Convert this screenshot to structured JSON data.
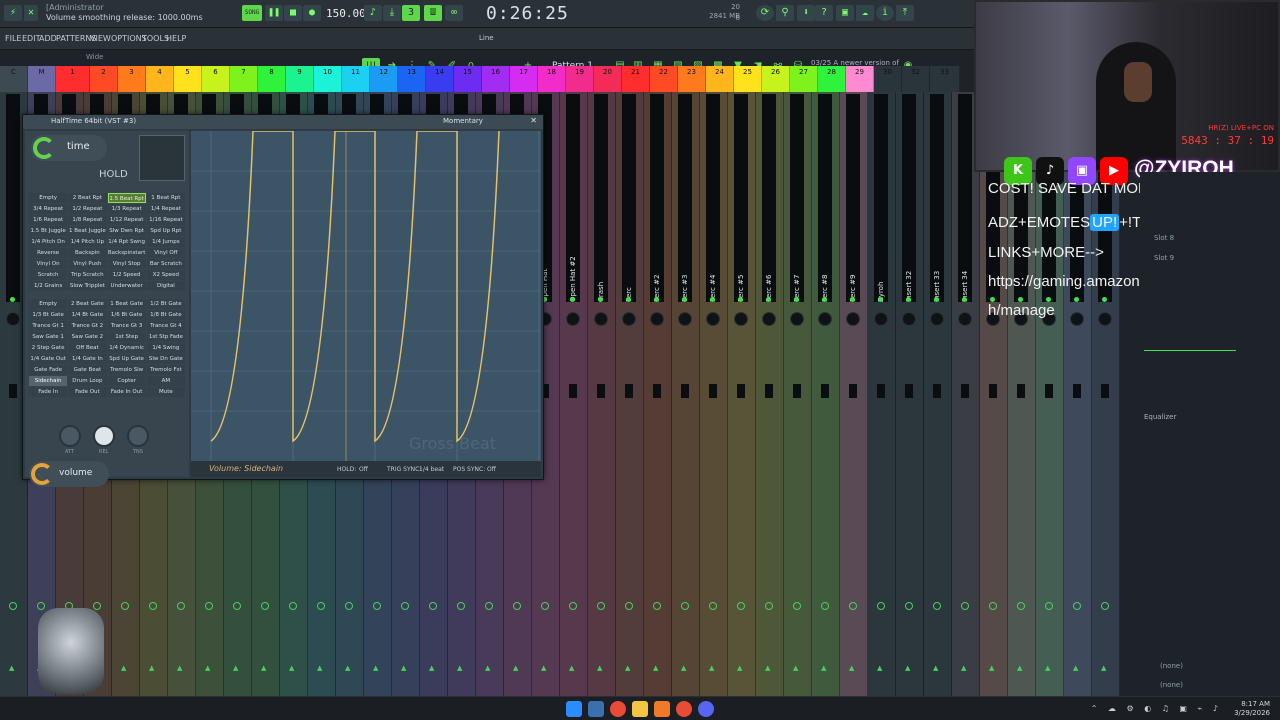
{
  "topbar": {
    "hint_admin": "[Administrator",
    "hint_text": "Volume smoothing release: 1000.00ms",
    "song_label": "SONG",
    "tempo": "150.000",
    "clock": "0:26:25",
    "mem": "2841 MB",
    "mem_small": "20",
    "cpu_small": "6"
  },
  "menubar": {
    "items": [
      "FILE",
      "EDIT",
      "ADD",
      "PATTERNS",
      "VIEW",
      "OPTIONS",
      "TOOLS",
      "HELP"
    ],
    "pattern": "Pattern 1",
    "line_label": "Line",
    "news_date": "03/25",
    "news_text": "A newer version of FL Studio is available!",
    "wide_label": "Wide"
  },
  "strip": {
    "cells": [
      "C",
      "M",
      "1",
      "2",
      "3",
      "4",
      "5",
      "6",
      "7",
      "8",
      "9",
      "10",
      "11",
      "12",
      "13",
      "14",
      "15",
      "16",
      "17",
      "18",
      "19",
      "20",
      "21",
      "22",
      "23",
      "24",
      "25",
      "26",
      "27",
      "28",
      "29",
      "30",
      "32",
      "33"
    ],
    "colors": [
      "#3d4a52",
      "#6b6aa6",
      "#ff2d2d",
      "#ff4a26",
      "#ff7a1c",
      "#ffb51c",
      "#ffe21c",
      "#c8f21c",
      "#7df21c",
      "#2ef23b",
      "#1cf28e",
      "#1cf2d6",
      "#1cd0f2",
      "#1c9bf2",
      "#1c64f2",
      "#3a3cf2",
      "#6e2cf2",
      "#a22cf2",
      "#d62cf2",
      "#f22cc8",
      "#f22c8c",
      "#f22c56",
      "#ff2d2d",
      "#ff4a26",
      "#ff7a1c",
      "#ffb51c",
      "#ffe21c",
      "#c8f21c",
      "#7df21c",
      "#2ef23b",
      "#ff8ad2",
      "#2a343b",
      "#2a343b",
      "#2a343b"
    ]
  },
  "mixer_labels": [
    "Open Hat",
    "Open Hat #2",
    "Crash",
    "Perc",
    "Perc #2",
    "Perc #3",
    "Perc #4",
    "Perc #5",
    "Perc #6",
    "Perc #7",
    "Perc #8",
    "Perc #9",
    "Zyroh",
    "Insert 32",
    "Insert 33",
    "Insert 34"
  ],
  "plugin": {
    "title": "HalfTime 64bit (VST #3)",
    "mode": "Momentary",
    "time_label": "time",
    "hold_label": "HOLD",
    "buttons_a": [
      "Empty",
      "2 Beat Rpt",
      "1.5 Beat Rpt",
      "1 Beat Rpt",
      "3/4 Repeat",
      "1/2 Repeat",
      "1/3 Repeat",
      "1/4 Repeat",
      "1/6 Repeat",
      "1/8 Repeat",
      "1/12 Repeat",
      "1/16 Repeat",
      "1.5 Bt Juggle",
      "1 Beat Juggle",
      "Slw Dwn Rpt",
      "Spd Up Rpt",
      "1/4 Pitch Dn",
      "1/4 Pitch Up",
      "1/4 Rpt Swng",
      "1/4 Jumps",
      "Reverse",
      "Backspin",
      "Backspinstart",
      "Vinyl Off",
      "Vinyl On",
      "Vinyl Push",
      "Vinyl Stop",
      "Bar Scratch",
      "Scratch",
      "Trip Scratch",
      "1/2 Speed",
      "X2 Speed",
      "1/2 Grains",
      "Slow Tripplet",
      "Underwater",
      "Digital"
    ],
    "buttons_b": [
      "Empty",
      "2 Beat Gate",
      "1 Beat Gate",
      "1/2 Bt Gate",
      "1/3 Bt Gate",
      "1/4 Bt Gate",
      "1/6 Bt Gate",
      "1/8 Bt Gate",
      "Trance Gt 1",
      "Trance Gt 2",
      "Trance Gt 3",
      "Trance Gt 4",
      "Saw Gate 1",
      "Saw Gate 2",
      "1st Step",
      "1st Stp Fade",
      "2 Step Gate",
      "Off Beat",
      "1/4 Dynamic",
      "1/4 Swing",
      "1/4 Gate Out",
      "1/4 Gate In",
      "Spd Up Gate",
      "Slw Dn Gate",
      "Gate Fade",
      "Gate Beat",
      "Tremolo Slw",
      "Tremolo Fst",
      "Sidechain",
      "Drum Loop",
      "Copter",
      "AM",
      "Fade In",
      "Fade Out",
      "Fade In Out",
      "Mute"
    ],
    "knob_labels": [
      "ATT",
      "REL",
      "TNS"
    ],
    "volume_label": "volume",
    "footer_title": "Volume: Sidechain",
    "hold_lbl": "HOLD:",
    "hold_val": "Off",
    "trig_lbl": "TRIG SYNC:",
    "trig_val": "1/4 beat",
    "pos_lbl": "POS SYNC:",
    "pos_val": "Off",
    "watermark": "Gross Beat"
  },
  "overlay": {
    "line1": "COST! SAVE DAT MON",
    "line2": "ADZ+EMOTES",
    "line2b": "UP!",
    "line2c": "+!TTS+SEND",
    "line3": "LINKS+MORE-->",
    "line4": "https://gaming.amazon.com/links/twitc",
    "line5": "h/manage",
    "handle": "@ZYIROH",
    "live": "HR(Z) LIVE+PC ON",
    "counter": "5843 : 37 : 19"
  },
  "rightpanel": {
    "slot8": "Slot 8",
    "slot9": "Slot 9",
    "equalizer": "Equalizer",
    "none1": "(none)",
    "none2": "(none)"
  },
  "taskbar": {
    "time": "8:17 AM",
    "date": "3/29/2026"
  }
}
